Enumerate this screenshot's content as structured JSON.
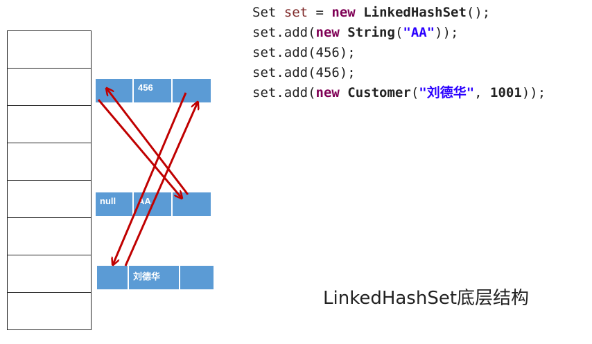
{
  "array_slots": 8,
  "nodes": {
    "node_456": {
      "prev": "",
      "value": "456",
      "next": ""
    },
    "node_aa": {
      "prev": "null",
      "value": "AA",
      "next": ""
    },
    "node_ldh": {
      "prev": "",
      "value": "刘德华",
      "next": ""
    }
  },
  "code": {
    "line1": {
      "t1": "Set ",
      "var": "set",
      "t2": " = ",
      "kw": "new",
      "t3": " ",
      "cls": "LinkedHashSet",
      "t4": "();"
    },
    "line2": {
      "t1": "set.add(",
      "kw": "new",
      "t2": " ",
      "cls": "String",
      "t3": "(",
      "str": "\"AA\"",
      "t4": "));"
    },
    "line3": "set.add(456);",
    "line4": "set.add(456);",
    "line5": {
      "t1": "set.add(",
      "kw": "new",
      "t2": " ",
      "cls": "Customer",
      "t3": "(",
      "str": "\"刘德华\"",
      "t4": ", ",
      "num": "1001",
      "t5": "));"
    }
  },
  "caption": "LinkedHashSet底层结构",
  "colors": {
    "node_fill": "#5b9bd5",
    "arrow": "#c00000",
    "keyword": "#7f0055",
    "string": "#2a00ff"
  }
}
